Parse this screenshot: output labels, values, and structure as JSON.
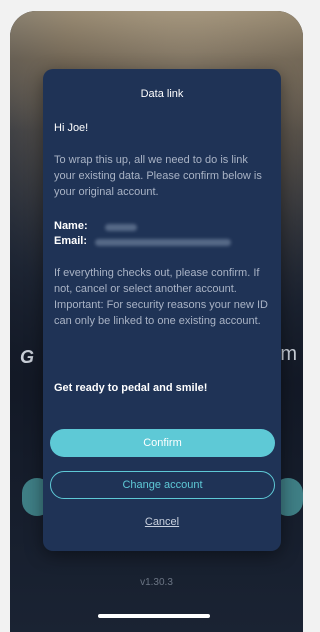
{
  "dialog": {
    "title": "Data link",
    "greeting": "Hi Joe!",
    "intro": "To wrap this up, all we need to do is link your existing data. Please confirm below is your original account.",
    "name_label": "Name:",
    "email_label": "Email:",
    "explain_1": "If everything checks out, please confirm. If not, cancel or select another account.",
    "explain_2": "Important: For security reasons your new ID can only be linked to one existing account.",
    "tagline": "Get ready to pedal and smile!",
    "confirm_label": "Confirm",
    "change_label": "Change account",
    "cancel_label": "Cancel"
  },
  "background": {
    "version": "v1.30.3"
  },
  "colors": {
    "dialog_bg": "#1f3356",
    "accent": "#5ec9d6"
  }
}
